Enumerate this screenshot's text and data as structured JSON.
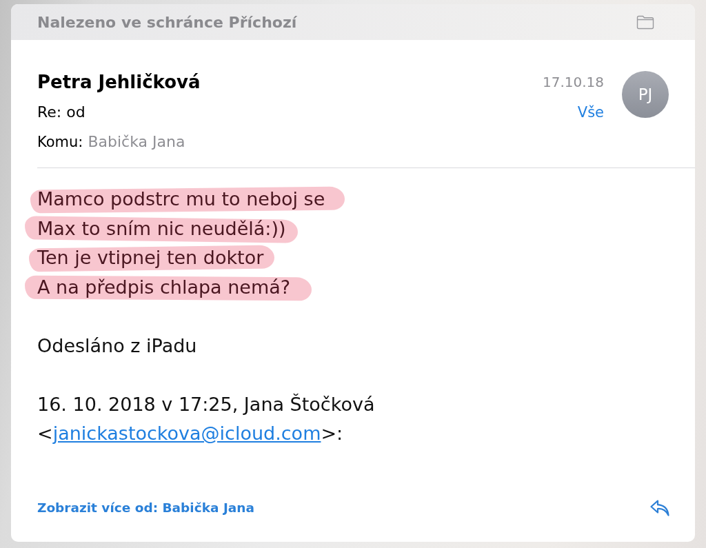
{
  "mailbox_banner": {
    "text": "Nalezeno ve schránce Příchozí"
  },
  "header": {
    "sender": "Petra Jehličková",
    "subject": "Re: od",
    "to_label": "Komu:",
    "to": "Babička Jana",
    "date": "17.10.18",
    "details_link": "Vše",
    "avatar_initials": "PJ"
  },
  "body": {
    "lines": [
      {
        "text": "Mamco podstrc mu to neboj se",
        "highlighted": true
      },
      {
        "text": "Max to sním nic neudělá:))",
        "highlighted": true
      },
      {
        "text": "Ten je vtipnej ten doktor",
        "highlighted": true
      },
      {
        "text": "A na předpis chlapa nemá?",
        "highlighted": true
      }
    ],
    "signature": "Odesláno z iPadu",
    "attribution": {
      "text": "16. 10. 2018 v 17:25, Jana Štočková",
      "open": "<",
      "email": "janickastockova@icloud.com",
      "close": ">:"
    }
  },
  "footer": {
    "more_from_link": "Zobrazit více od: Babička Jana"
  }
}
